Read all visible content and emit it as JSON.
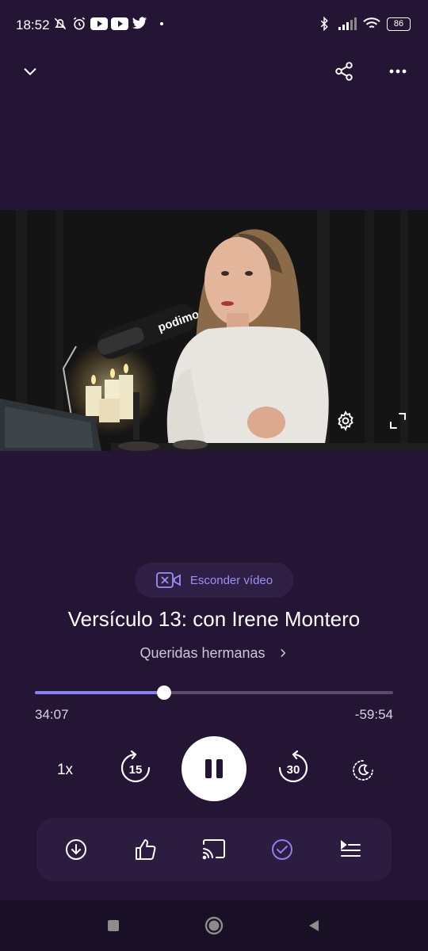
{
  "status_bar": {
    "time": "18:52",
    "battery": "86",
    "left_icons": [
      "bell-off-icon",
      "alarm-icon",
      "youtube-icon",
      "youtube-icon",
      "twitter-icon",
      "dot-icon"
    ],
    "right_icons": [
      "bluetooth-icon",
      "signal-icon",
      "wifi-icon"
    ]
  },
  "topbar": {
    "collapse_icon": "chevron-down-icon",
    "share_icon": "share-icon",
    "more_icon": "more-icon"
  },
  "video": {
    "brand_on_mic": "podimo",
    "settings_icon": "gear-icon",
    "fullscreen_icon": "fullscreen-icon"
  },
  "hide_video": {
    "label": "Esconder vídeo",
    "icon": "video-off-icon"
  },
  "episode": {
    "title": "Versículo 13: con Irene Montero",
    "show": "Queridas hermanas"
  },
  "progress": {
    "elapsed": "34:07",
    "remaining": "-59:54",
    "fraction": 0.36
  },
  "controls": {
    "speed": "1x",
    "rewind_seconds": "15",
    "forward_seconds": "30",
    "play_icon": "pause-icon",
    "sleep_icon": "sleep-timer-icon"
  },
  "actions": [
    "download-icon",
    "like-icon",
    "cast-icon",
    "mark-played-icon",
    "queue-icon"
  ],
  "colors": {
    "background": "#241534",
    "accent": "#8a80f0",
    "accent_text": "#9b8ff6"
  }
}
